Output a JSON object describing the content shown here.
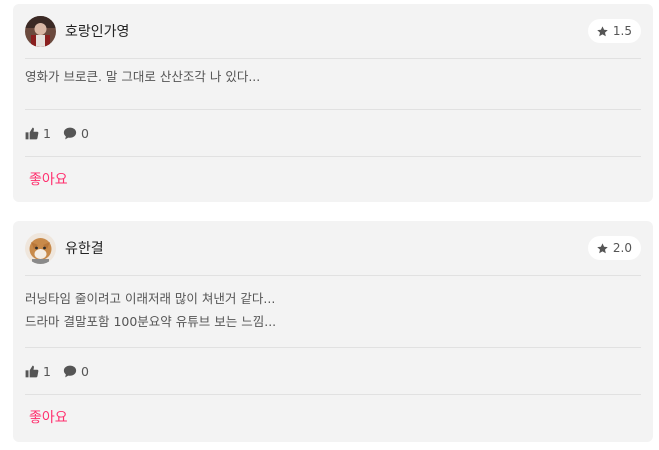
{
  "colors": {
    "card_background": "#f3f3f3",
    "accent_like": "#ff2f6e",
    "text_muted": "#555555"
  },
  "comments": [
    {
      "username": "호랑인가영",
      "avatar_icon": "user-avatar-photo",
      "rating": "1.5",
      "text_lines": [
        "영화가 브로큰. 말 그대로 산산조각 나 있다..."
      ],
      "likes": "1",
      "replies": "0",
      "like_label": "좋아요"
    },
    {
      "username": "유한결",
      "avatar_icon": "cat-avatar-photo",
      "rating": "2.0",
      "text_lines": [
        "러닝타임 줄이려고 이래저래 많이 쳐낸거 같다...",
        "드라마 결말포함 100분요약 유튜브 보는 느낌..."
      ],
      "likes": "1",
      "replies": "0",
      "like_label": "좋아요"
    }
  ]
}
